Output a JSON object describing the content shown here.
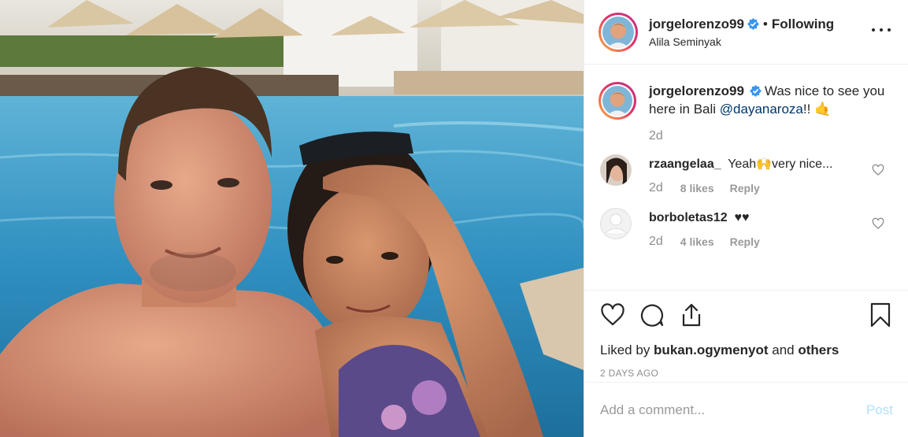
{
  "post": {
    "author": "jorgelorenzo99",
    "follow_separator": "•",
    "follow_status": "Following",
    "location": "Alila Seminyak",
    "more_icon": "more-horizontal-icon",
    "verified_icon": "verified-badge-icon",
    "colors": {
      "verified": "#3897f0",
      "link": "#003569",
      "muted": "#8e8e8e",
      "post_disabled": "#b2dffc"
    }
  },
  "caption": {
    "username": "jorgelorenzo99",
    "text": "Was nice to see you here in Bali ",
    "mention": "@dayanaroza",
    "suffix": "!! 🤙",
    "time": "2d"
  },
  "comments": [
    {
      "username": "rzaangelaa_",
      "text": "Yeah🙌very nice...",
      "time": "2d",
      "likes": "8 likes",
      "reply": "Reply"
    },
    {
      "username": "borboletas12",
      "text": "♥♥",
      "time": "2d",
      "likes": "4 likes",
      "reply": "Reply"
    }
  ],
  "actions": {
    "liked_prefix": "Liked by ",
    "liked_user": "bukan.ogymenyot",
    "liked_and": " and ",
    "liked_others": "others",
    "timestamp": "2 DAYS AGO",
    "icons": [
      "heart-icon",
      "comment-icon",
      "share-icon",
      "bookmark-icon"
    ]
  },
  "composer": {
    "placeholder": "Add a comment...",
    "post_label": "Post"
  }
}
